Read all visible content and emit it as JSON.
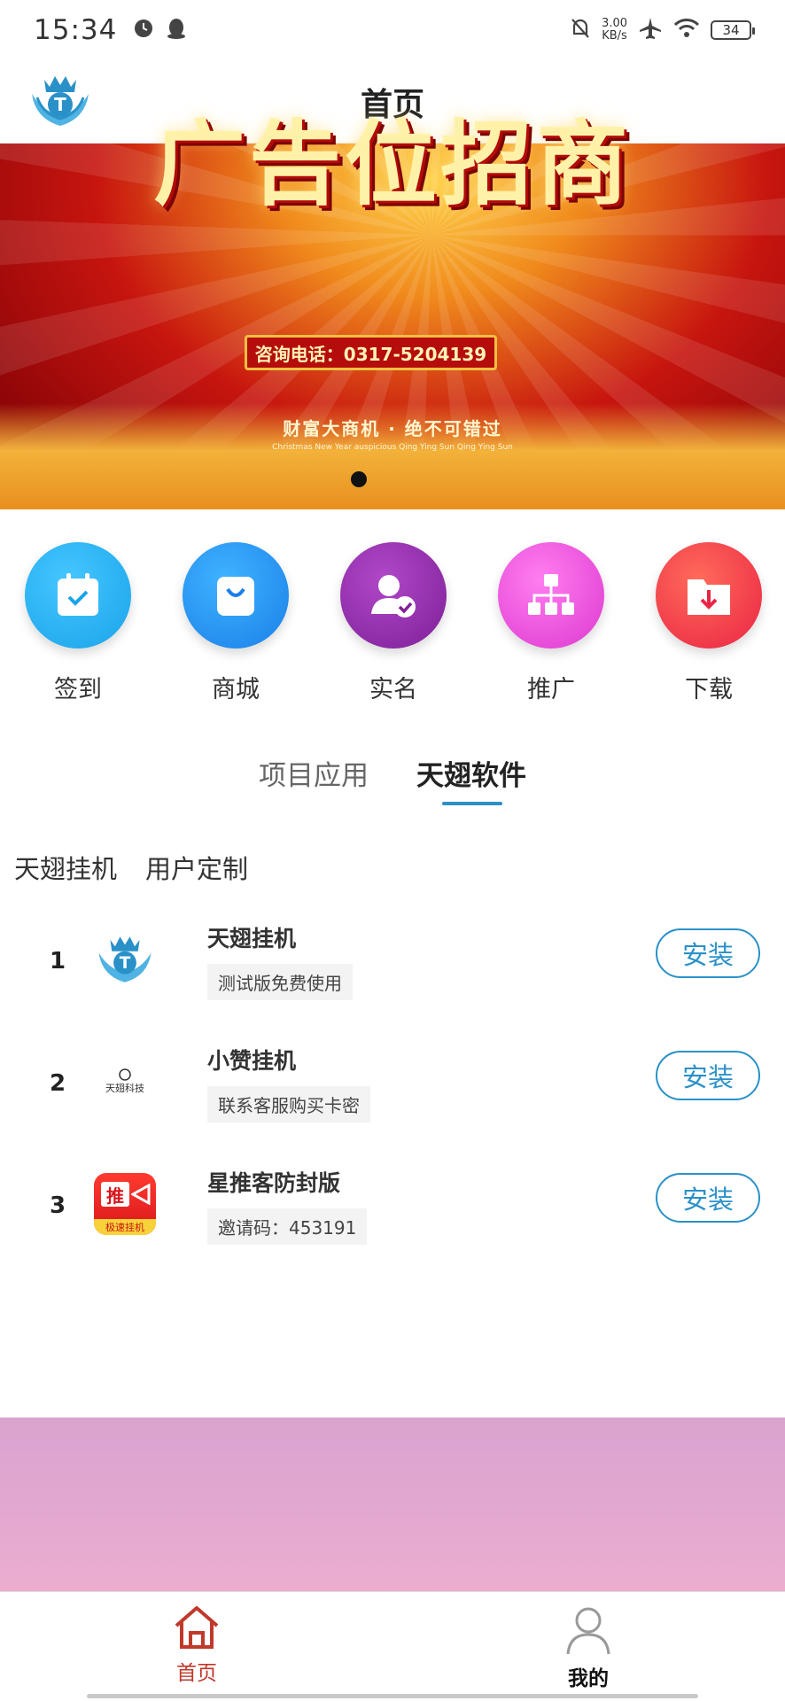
{
  "status_bar": {
    "time": "15:34",
    "speed_value": "3.00",
    "speed_unit": "KB/s",
    "battery": "34"
  },
  "header": {
    "title": "首页"
  },
  "banner": {
    "headline": "广告位招商",
    "phone": "咨询电话：0317-5204139",
    "slogan": "财富大商机 · 绝不可错过",
    "small_text": "Christmas New Year auspicious Qing Ying Sun Qing Ying Sun"
  },
  "features": [
    {
      "label": "签到",
      "color": "#1aa4ea"
    },
    {
      "label": "商城",
      "color": "#1a84ee"
    },
    {
      "label": "实名",
      "color": "#8a2aa2"
    },
    {
      "label": "推广",
      "color": "#e24ad2"
    },
    {
      "label": "下载",
      "color": "#f0343e"
    }
  ],
  "tabs": {
    "project": "项目应用",
    "software": "天翅软件"
  },
  "subtabs": {
    "first": "天翅挂机",
    "second": "用户定制"
  },
  "apps": [
    {
      "index": "1",
      "name": "天翅挂机",
      "desc": "测试版免费使用",
      "button": "安装"
    },
    {
      "index": "2",
      "name": "小赞挂机",
      "desc": "联系客服购买卡密",
      "button": "安装",
      "icon_text": "天翅科技"
    },
    {
      "index": "3",
      "name": "星推客防封版",
      "desc": "邀请码：453191",
      "button": "安装",
      "icon_text": "推",
      "icon_sub": "极速挂机"
    }
  ],
  "bottom_nav": {
    "home": "首页",
    "me": "我的"
  },
  "colors": {
    "accent": "#2a91c8",
    "nav_active": "#c0392b"
  }
}
